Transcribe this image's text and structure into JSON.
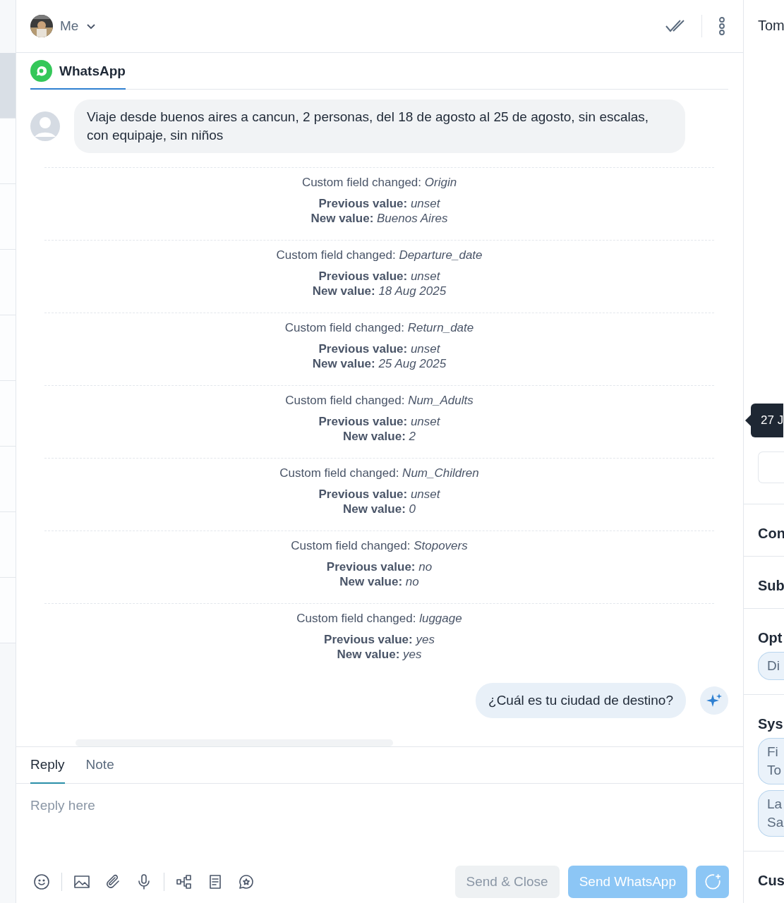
{
  "conversation_list": [
    {
      "selected": true
    },
    {
      "selected": false
    },
    {
      "selected": false
    },
    {
      "selected": false
    },
    {
      "selected": false
    },
    {
      "selected": false
    },
    {
      "selected": false
    },
    {
      "selected": false
    },
    {
      "selected": false
    }
  ],
  "header": {
    "assignee": "Me"
  },
  "channel_tab": {
    "label": "WhatsApp",
    "selected": true
  },
  "incoming_message": "Viaje desde buenos aires a cancun, 2 personas, del 18 de agosto al 25 de agosto, sin escalas, con equipaje, sin niños",
  "field_changes": [
    {
      "prefix": "Custom field changed:",
      "field": "Origin",
      "previous_label": "Previous value:",
      "previous": "unset",
      "new_label": "New value:",
      "new": "Buenos Aires"
    },
    {
      "prefix": "Custom field changed:",
      "field": "Departure_date",
      "previous_label": "Previous value:",
      "previous": "unset",
      "new_label": "New value:",
      "new": "18 Aug 2025"
    },
    {
      "prefix": "Custom field changed:",
      "field": "Return_date",
      "previous_label": "Previous value:",
      "previous": "unset",
      "new_label": "New value:",
      "new": "25 Aug 2025"
    },
    {
      "prefix": "Custom field changed:",
      "field": "Num_Adults",
      "previous_label": "Previous value:",
      "previous": "unset",
      "new_label": "New value:",
      "new": "2"
    },
    {
      "prefix": "Custom field changed:",
      "field": "Num_Children",
      "previous_label": "Previous value:",
      "previous": "unset",
      "new_label": "New value:",
      "new": "0"
    },
    {
      "prefix": "Custom field changed:",
      "field": "Stopovers",
      "previous_label": "Previous value:",
      "previous": "no",
      "new_label": "New value:",
      "new": "no"
    },
    {
      "prefix": "Custom field changed:",
      "field": "luggage",
      "previous_label": "Previous value:",
      "previous": "yes",
      "new_label": "New value:",
      "new": "yes"
    }
  ],
  "outgoing_message": "¿Cuál es tu ciudad de destino?",
  "composer": {
    "tabs": [
      {
        "label": "Reply",
        "selected": true
      },
      {
        "label": "Note",
        "selected": false
      }
    ],
    "placeholder": "Reply here",
    "buttons": [
      {
        "label": "Send & Close",
        "kind": "secondary"
      },
      {
        "label": "Send WhatsApp",
        "kind": "primary"
      }
    ]
  },
  "side_panel": {
    "title": "Tom",
    "tooltip": "27 J",
    "sections": [
      {
        "title": "Con"
      },
      {
        "title": "Sub"
      },
      {
        "title": "Opt",
        "chips": [
          [
            "Di"
          ]
        ]
      },
      {
        "title": "Sys",
        "chips": [
          [
            "Fi",
            "To"
          ],
          [
            "La",
            "Sa"
          ]
        ]
      },
      {
        "title": "Cus"
      }
    ]
  }
}
